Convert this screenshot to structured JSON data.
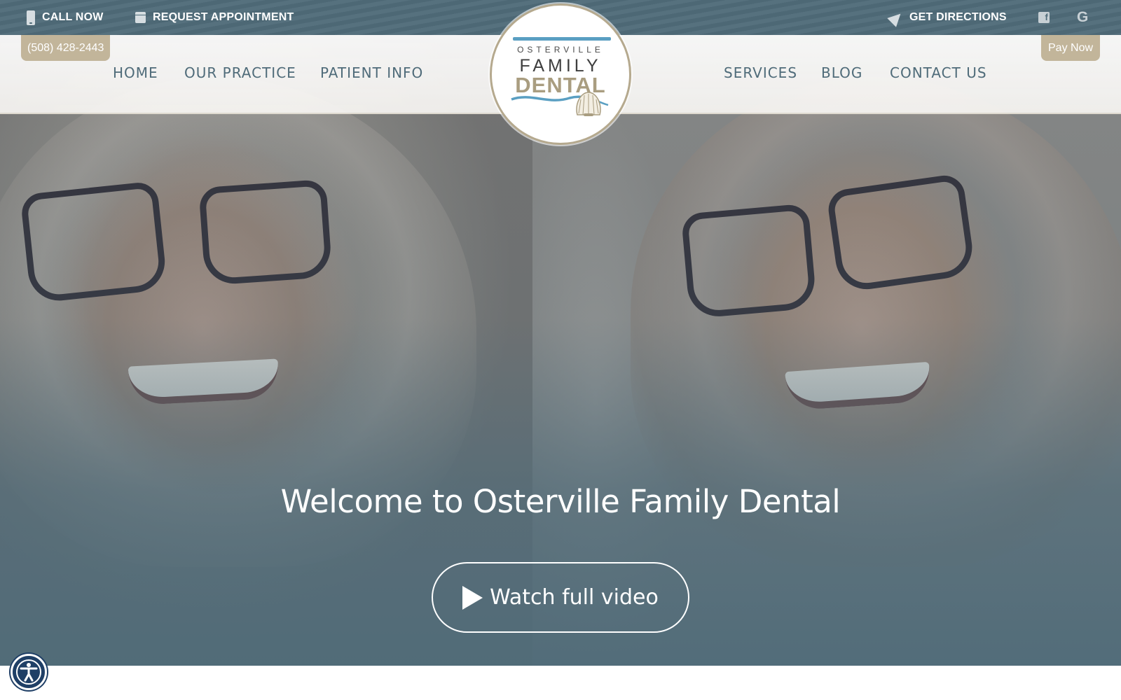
{
  "topbar": {
    "call_label": "CALL NOW",
    "appointment_label": "REQUEST APPOINTMENT",
    "directions_label": "GET DIRECTIONS",
    "facebook_icon": "facebook-icon",
    "google_icon": "google-icon"
  },
  "phone_tab": "(508) 428-2443",
  "pay_tab": "Pay Now",
  "nav": {
    "left": [
      "HOME",
      "OUR PRACTICE",
      "PATIENT INFO"
    ],
    "right": [
      "SERVICES",
      "BLOG",
      "CONTACT US"
    ]
  },
  "logo": {
    "line1": "OSTERVILLE",
    "line2": "FAMILY",
    "line3": "DENTAL"
  },
  "hero": {
    "title": "Welcome to Osterville Family Dental",
    "cta_label": "Watch full video"
  },
  "colors": {
    "primary": "#4f6b79",
    "accent": "#c2b59a",
    "logo_blue": "#5a9fc2",
    "a11y_blue": "#1f3f66"
  }
}
